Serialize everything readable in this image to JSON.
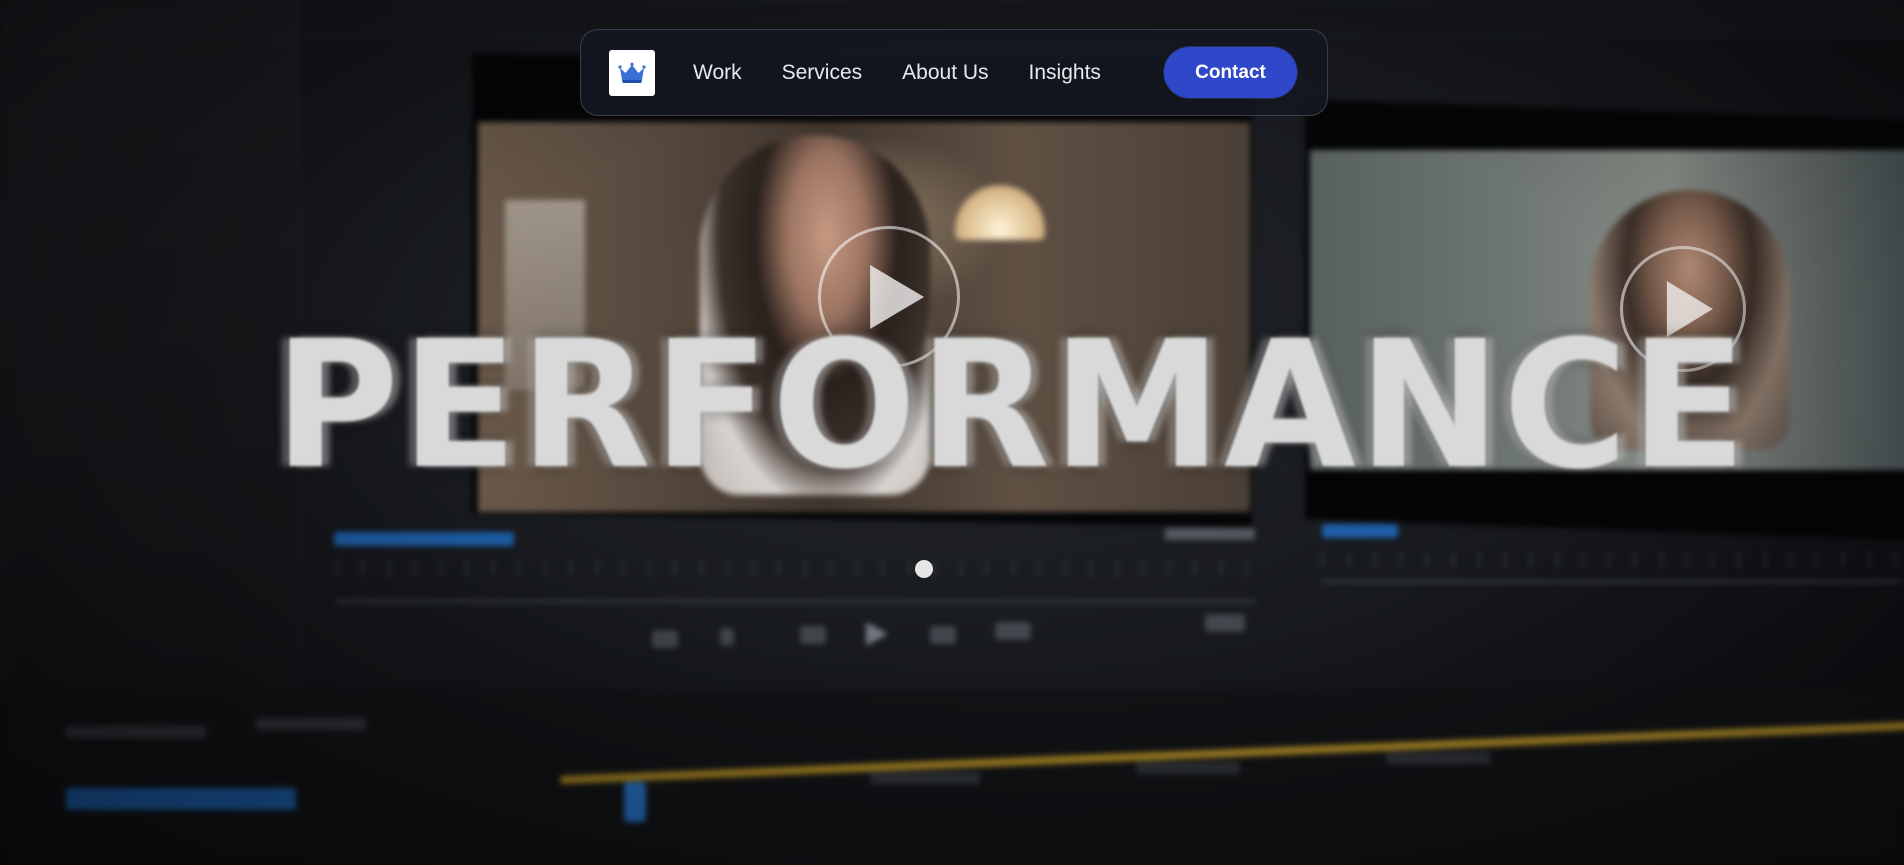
{
  "nav": {
    "logo_icon": "crown-icon",
    "links": [
      {
        "label": "Work"
      },
      {
        "label": "Services"
      },
      {
        "label": "About Us"
      },
      {
        "label": "Insights"
      }
    ],
    "contact_label": "Contact"
  },
  "hero": {
    "headline": "PERFORMANCE",
    "background_icon": "play-icon"
  },
  "colors": {
    "accent": "#2f47c9",
    "logo_crown": "#3a6fd6",
    "headline": "#d9d9d9",
    "timeline_track": "#d9ad2f"
  }
}
